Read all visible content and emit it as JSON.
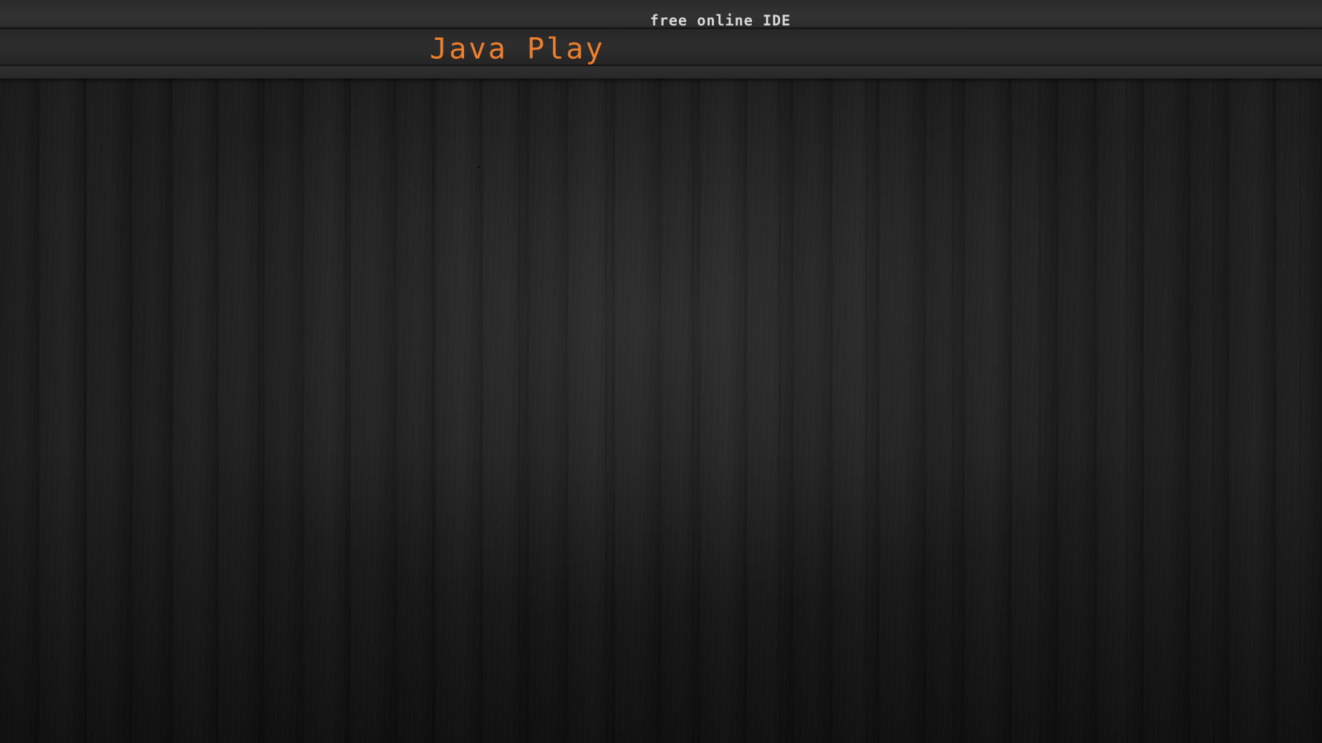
{
  "header": {
    "tagline": "free online IDE",
    "app_title": "Java Play"
  },
  "colors": {
    "title_accent": "#f07f2a",
    "tagline_text": "#d8d8d8",
    "background": "#1c1c1c"
  }
}
